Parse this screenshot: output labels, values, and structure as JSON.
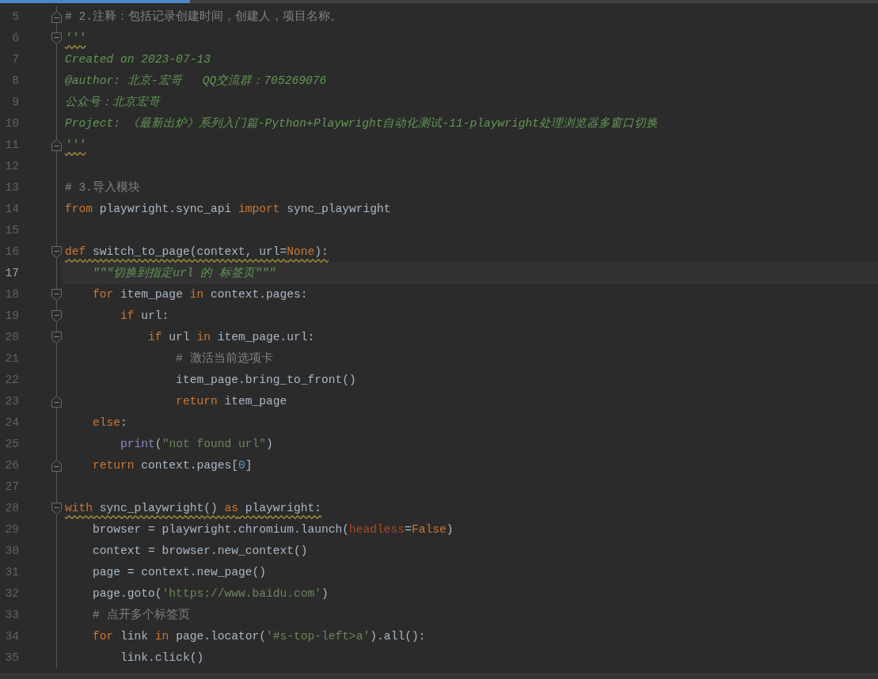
{
  "lines": [
    {
      "number": "5",
      "current": false,
      "warning": false,
      "fold_start": false,
      "fold_end": true,
      "tokens": [
        {
          "kind": "comment",
          "t": "# 2.注释：包括记录创建时间，创建人，项目名称。"
        }
      ]
    },
    {
      "number": "6",
      "current": false,
      "warning": true,
      "fold_start": true,
      "fold_end": false,
      "tokens": [
        {
          "kind": "doc",
          "t": "'''"
        }
      ]
    },
    {
      "number": "7",
      "current": false,
      "warning": false,
      "fold_start": false,
      "fold_end": false,
      "tokens": [
        {
          "kind": "doc",
          "t": "Created on 2023-07-13"
        }
      ]
    },
    {
      "number": "8",
      "current": false,
      "warning": false,
      "fold_start": false,
      "fold_end": false,
      "tokens": [
        {
          "kind": "doc",
          "t": "@author: 北京-宏哥   QQ交流群：705269076"
        }
      ]
    },
    {
      "number": "9",
      "current": false,
      "warning": false,
      "fold_start": false,
      "fold_end": false,
      "tokens": [
        {
          "kind": "doc",
          "t": "公众号：北京宏哥"
        }
      ]
    },
    {
      "number": "10",
      "current": false,
      "warning": false,
      "fold_start": false,
      "fold_end": false,
      "tokens": [
        {
          "kind": "doc",
          "t": "Project: 《最新出炉》系列入门篇-Python+Playwright自动化测试-11-playwright处理浏览器多窗口切换"
        }
      ]
    },
    {
      "number": "11",
      "current": false,
      "warning": true,
      "fold_start": false,
      "fold_end": true,
      "tokens": [
        {
          "kind": "doc",
          "t": "'''"
        }
      ]
    },
    {
      "number": "12",
      "current": false,
      "warning": false,
      "fold_start": false,
      "fold_end": false
    },
    {
      "number": "13",
      "current": false,
      "warning": false,
      "fold_start": false,
      "fold_end": false,
      "tokens": [
        {
          "kind": "comment",
          "t": "# 3.导入模块"
        }
      ]
    },
    {
      "number": "14",
      "current": false,
      "warning": false,
      "fold_start": false,
      "fold_end": false,
      "tokens": [
        {
          "kind": "kw",
          "t": "from"
        },
        {
          "kind": "plain",
          "t": " playwright.sync_api "
        },
        {
          "kind": "kw",
          "t": "import"
        },
        {
          "kind": "plain",
          "t": " sync_playwright"
        }
      ]
    },
    {
      "number": "15",
      "current": false,
      "warning": false,
      "fold_start": false,
      "fold_end": false
    },
    {
      "number": "16",
      "current": false,
      "warning": true,
      "fold_start": true,
      "fold_end": false,
      "tokens": [
        {
          "kind": "kw",
          "t": "def"
        },
        {
          "kind": "plain",
          "t": " switch_to_page(context, url="
        },
        {
          "kind": "kw",
          "t": "None"
        },
        {
          "kind": "plain",
          "t": "):"
        }
      ]
    },
    {
      "number": "17",
      "current": true,
      "warning": false,
      "fold_start": false,
      "fold_end": false,
      "tokens": [
        {
          "kind": "doc",
          "t": "    \"\"\"切换到指定url 的 标签页\"\"\""
        }
      ]
    },
    {
      "number": "18",
      "current": false,
      "warning": false,
      "fold_start": true,
      "fold_end": false,
      "tokens": [
        {
          "kind": "kw",
          "t": "    for"
        },
        {
          "kind": "plain",
          "t": " item_page "
        },
        {
          "kind": "kw",
          "t": "in"
        },
        {
          "kind": "plain",
          "t": " context.pages:"
        }
      ]
    },
    {
      "number": "19",
      "current": false,
      "warning": false,
      "fold_start": true,
      "fold_end": false,
      "tokens": [
        {
          "kind": "kw",
          "t": "        if"
        },
        {
          "kind": "plain",
          "t": " url:"
        }
      ]
    },
    {
      "number": "20",
      "current": false,
      "warning": false,
      "fold_start": true,
      "fold_end": false,
      "tokens": [
        {
          "kind": "kw",
          "t": "            if"
        },
        {
          "kind": "plain",
          "t": " url "
        },
        {
          "kind": "kw",
          "t": "in"
        },
        {
          "kind": "plain",
          "t": " item_page.url:"
        }
      ]
    },
    {
      "number": "21",
      "current": false,
      "warning": false,
      "fold_start": false,
      "fold_end": false,
      "tokens": [
        {
          "kind": "comment",
          "t": "                # 激活当前选项卡"
        }
      ]
    },
    {
      "number": "22",
      "current": false,
      "warning": false,
      "fold_start": false,
      "fold_end": false,
      "tokens": [
        {
          "kind": "plain",
          "t": "                item_page.bring_to_front()"
        }
      ]
    },
    {
      "number": "23",
      "current": false,
      "warning": false,
      "fold_start": false,
      "fold_end": true,
      "tokens": [
        {
          "kind": "kw",
          "t": "                return"
        },
        {
          "kind": "plain",
          "t": " item_page"
        }
      ]
    },
    {
      "number": "24",
      "current": false,
      "warning": false,
      "fold_start": false,
      "fold_end": false,
      "tokens": [
        {
          "kind": "kw",
          "t": "    else"
        },
        {
          "kind": "plain",
          "t": ":"
        }
      ]
    },
    {
      "number": "25",
      "current": false,
      "warning": false,
      "fold_start": false,
      "fold_end": false,
      "tokens": [
        {
          "kind": "builtin",
          "t": "        print"
        },
        {
          "kind": "plain",
          "t": "("
        },
        {
          "kind": "str",
          "t": "\"not found url\""
        },
        {
          "kind": "plain",
          "t": ")"
        }
      ]
    },
    {
      "number": "26",
      "current": false,
      "warning": false,
      "fold_start": false,
      "fold_end": true,
      "tokens": [
        {
          "kind": "kw",
          "t": "    return"
        },
        {
          "kind": "plain",
          "t": " context.pages["
        },
        {
          "kind": "num",
          "t": "0"
        },
        {
          "kind": "plain",
          "t": "]"
        }
      ]
    },
    {
      "number": "27",
      "current": false,
      "warning": false,
      "fold_start": false,
      "fold_end": false
    },
    {
      "number": "28",
      "current": false,
      "warning": true,
      "fold_start": true,
      "fold_end": false,
      "tokens": [
        {
          "kind": "kw",
          "t": "with"
        },
        {
          "kind": "plain",
          "t": " sync_playwright() "
        },
        {
          "kind": "kw",
          "t": "as"
        },
        {
          "kind": "plain",
          "t": " playwright:"
        }
      ]
    },
    {
      "number": "29",
      "current": false,
      "warning": false,
      "fold_start": false,
      "fold_end": false,
      "tokens": [
        {
          "kind": "plain",
          "t": "    browser = playwright.chromium.launch("
        },
        {
          "kind": "param",
          "t": "headless"
        },
        {
          "kind": "plain",
          "t": "="
        },
        {
          "kind": "kw",
          "t": "False"
        },
        {
          "kind": "plain",
          "t": ")"
        }
      ]
    },
    {
      "number": "30",
      "current": false,
      "warning": false,
      "fold_start": false,
      "fold_end": false,
      "tokens": [
        {
          "kind": "plain",
          "t": "    context = browser.new_context()"
        }
      ]
    },
    {
      "number": "31",
      "current": false,
      "warning": false,
      "fold_start": false,
      "fold_end": false,
      "tokens": [
        {
          "kind": "plain",
          "t": "    page = context.new_page()"
        }
      ]
    },
    {
      "number": "32",
      "current": false,
      "warning": false,
      "fold_start": false,
      "fold_end": false,
      "tokens": [
        {
          "kind": "plain",
          "t": "    page.goto("
        },
        {
          "kind": "str",
          "t": "'https://www.baidu.com'"
        },
        {
          "kind": "plain",
          "t": ")"
        }
      ]
    },
    {
      "number": "33",
      "current": false,
      "warning": false,
      "fold_start": false,
      "fold_end": false,
      "tokens": [
        {
          "kind": "comment",
          "t": "    # 点开多个标签页"
        }
      ]
    },
    {
      "number": "34",
      "current": false,
      "warning": false,
      "fold_start": false,
      "fold_end": false,
      "tokens": [
        {
          "kind": "kw",
          "t": "    for"
        },
        {
          "kind": "plain",
          "t": " link "
        },
        {
          "kind": "kw",
          "t": "in"
        },
        {
          "kind": "plain",
          "t": " page.locator("
        },
        {
          "kind": "str",
          "t": "'#s-top-left>a'"
        },
        {
          "kind": "plain",
          "t": ").all():"
        }
      ]
    },
    {
      "number": "35",
      "current": false,
      "warning": false,
      "fold_start": false,
      "fold_end": false,
      "tokens": [
        {
          "kind": "plain",
          "t": "        link.click()"
        }
      ]
    }
  ]
}
